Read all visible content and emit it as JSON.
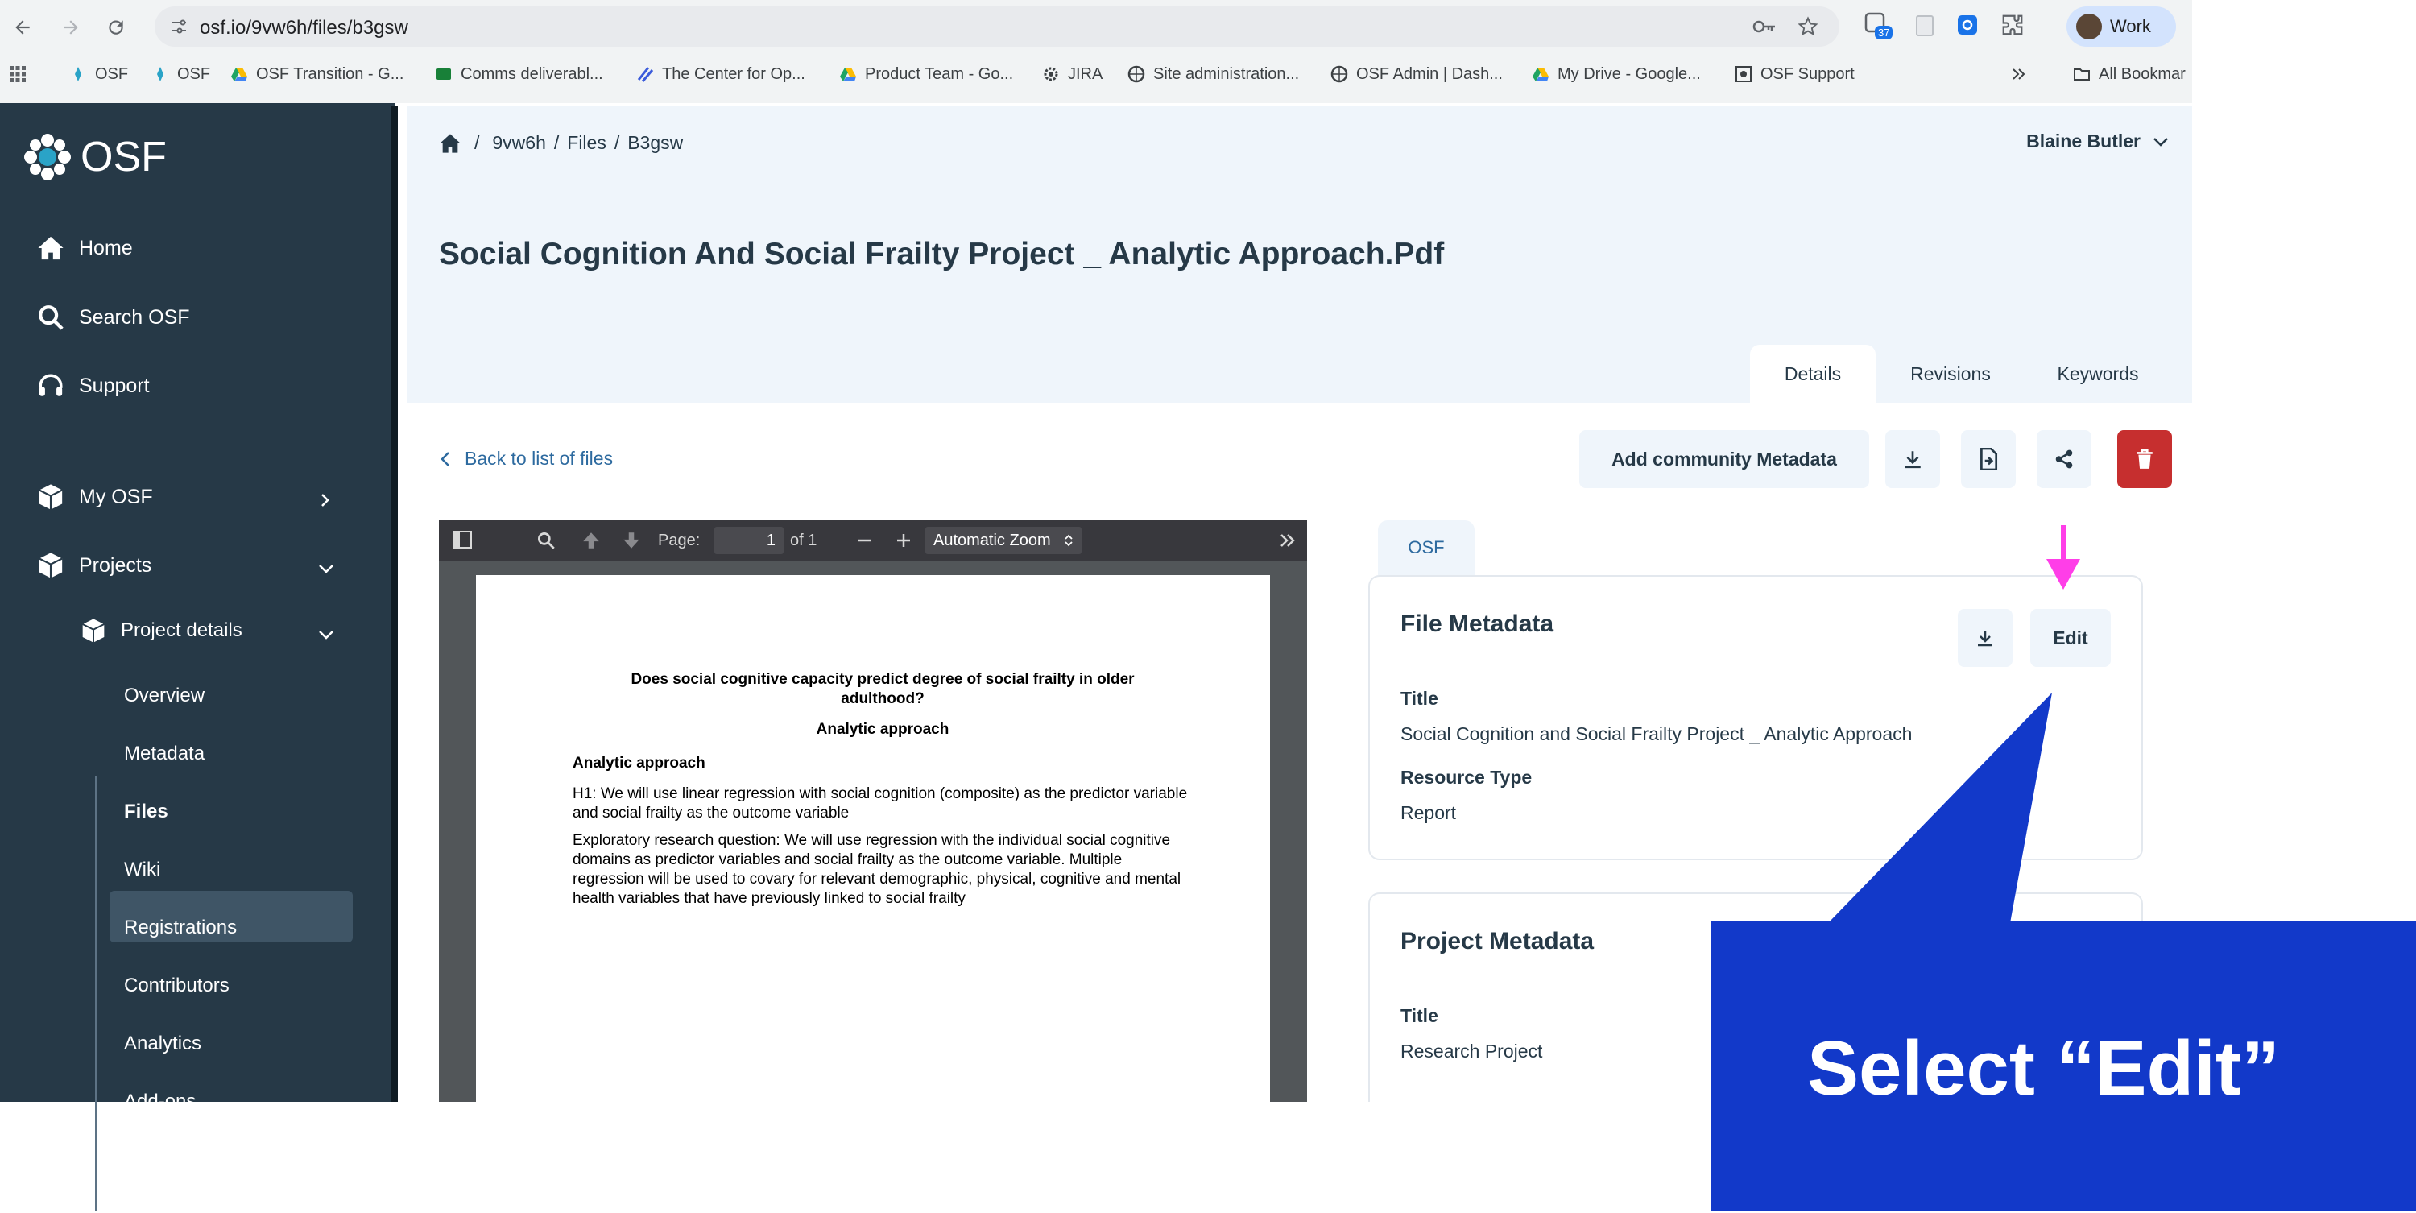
{
  "browser": {
    "url": "osf.io/9vw6h/files/b3gsw",
    "extension_badge": "37",
    "profile_label": "Work",
    "bookmarks": [
      {
        "label": "OSF"
      },
      {
        "label": "OSF"
      },
      {
        "label": "OSF Transition - G..."
      },
      {
        "label": "Comms deliverabl..."
      },
      {
        "label": "The Center for Op..."
      },
      {
        "label": "Product Team - Go..."
      },
      {
        "label": "JIRA"
      },
      {
        "label": "Site administration..."
      },
      {
        "label": "OSF Admin | Dash..."
      },
      {
        "label": "My Drive - Google..."
      },
      {
        "label": "OSF Support"
      }
    ],
    "all_bookmarks_label": "All Bookmar"
  },
  "sidebar": {
    "logo_text": "OSF",
    "home": "Home",
    "search": "Search OSF",
    "support": "Support",
    "my_osf": "My OSF",
    "projects": "Projects",
    "project_details": "Project details",
    "sub_items": [
      "Overview",
      "Metadata",
      "Files",
      "Wiki",
      "Registrations",
      "Contributors",
      "Analytics",
      "Add-ons"
    ]
  },
  "header": {
    "breadcrumb_project": "9vw6h",
    "breadcrumb_files": "Files",
    "breadcrumb_file": "B3gsw",
    "separator": "/",
    "user_name": "Blaine Butler",
    "title": "Social Cognition And Social Frailty Project _ Analytic Approach.Pdf",
    "tabs": [
      "Details",
      "Revisions",
      "Keywords"
    ]
  },
  "actions": {
    "back_label": "Back to list of files",
    "add_metadata_label": "Add community Metadata"
  },
  "pdf": {
    "page_label": "Page:",
    "page_value": "1",
    "page_of": "of 1",
    "zoom": "Automatic Zoom",
    "heading": "Does social cognitive capacity predict degree of social frailty in older adulthood?",
    "subheading": "Analytic approach",
    "section": "Analytic approach",
    "h1_text": "H1: We will use linear regression with social cognition (composite) as the predictor variable and social frailty as the outcome variable",
    "exploratory_text": "Exploratory research question: We will use regression with the individual social cognitive domains as predictor variables and social frailty as the outcome variable. Multiple regression will be used to covary for relevant demographic, physical, cognitive and mental health variables that have previously linked to social frailty"
  },
  "metadata": {
    "tab_label": "OSF",
    "file_card": {
      "title": "File Metadata",
      "edit_label": "Edit",
      "title_label": "Title",
      "title_value": "Social Cognition and Social Frailty Project _ Analytic Approach",
      "resource_type_label": "Resource Type",
      "resource_type_value": "Report"
    },
    "project_card": {
      "title": "Project Metadata",
      "title_label": "Title",
      "title_value": "Research Project"
    }
  },
  "annotation": {
    "callout_text": "Select “Edit”",
    "arrow_color": "#ff3ee8",
    "callout_color": "#1239c9"
  },
  "colors": {
    "sidebar": "#263947",
    "header_band": "#eff5fb",
    "link": "#2d6a9f",
    "danger": "#c62f2f"
  }
}
